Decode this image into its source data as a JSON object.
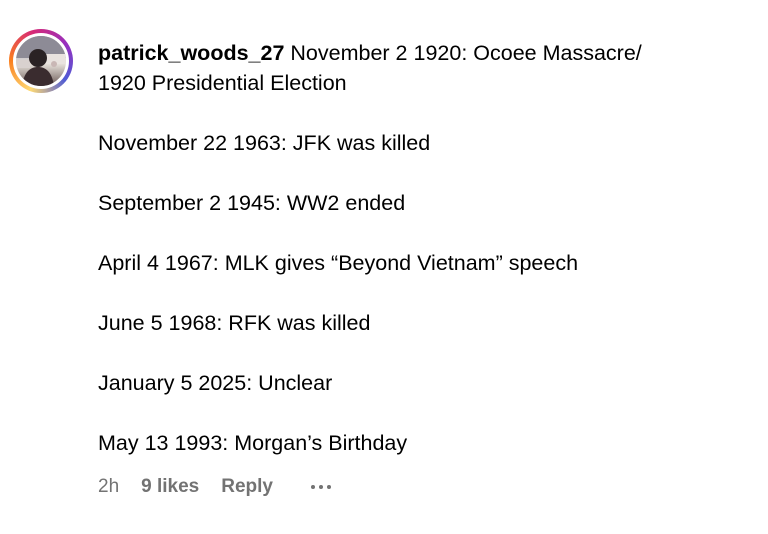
{
  "comment": {
    "username": "patrick_woods_27",
    "first_line": "November 2 1920: Ocoee Massacre/",
    "second_line": "1920 Presidential Election",
    "entries": [
      "November 22 1963: JFK was killed",
      "September 2 1945: WW2 ended",
      "April 4 1967: MLK gives “Beyond Vietnam” speech",
      "June 5 1968: RFK was killed",
      "January 5 2025: Unclear",
      "May 13 1993: Morgan’s Birthday"
    ],
    "time": "2h",
    "likes": "9 likes",
    "reply_label": "Reply",
    "more_icon": "more-horizontal-icon"
  },
  "colors": {
    "text": "#000000",
    "meta_text": "#737373",
    "story_ring_start": "#feda75",
    "story_ring_mid": "#d62976",
    "story_ring_end": "#4f5bd5"
  }
}
